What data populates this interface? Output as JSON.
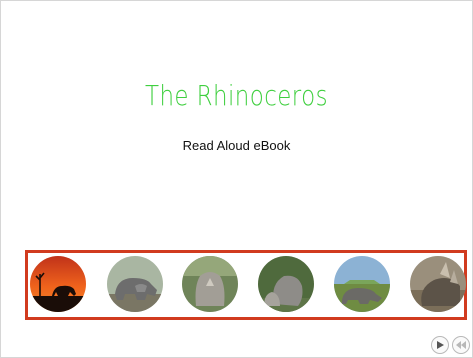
{
  "slide": {
    "title": "The Rhinoceros",
    "subtitle": "Read Aloud eBook"
  },
  "thumbnails": [
    {
      "icon": "sunset-rhino-silhouette-icon"
    },
    {
      "icon": "rhino-photo-icon"
    },
    {
      "icon": "rhino-front-photo-icon"
    },
    {
      "icon": "rhino-calf-photo-icon"
    },
    {
      "icon": "rhino-grazing-photo-icon"
    },
    {
      "icon": "rhino-closeup-photo-icon"
    }
  ],
  "colors": {
    "title": "#3fcf3f",
    "strip_border": "#d13b1f"
  },
  "nav": {
    "play_icon": "play-icon",
    "previous_icon": "rewind-icon"
  }
}
